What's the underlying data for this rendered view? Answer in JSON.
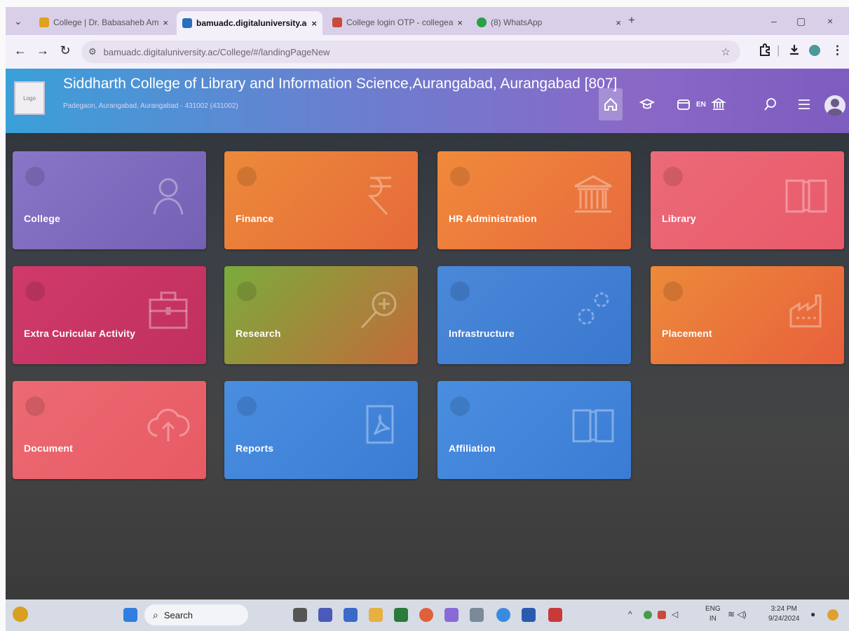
{
  "browser": {
    "tabs": [
      {
        "title": "College | Dr. Babasaheb Ambe",
        "active": false,
        "favicon_color": "#e0a020"
      },
      {
        "title": "bamuadc.digitaluniversity.ac/C",
        "active": true,
        "favicon_color": "#2a6ec0"
      },
      {
        "title": "College login OTP - collegeac",
        "active": false,
        "favicon_color": "#c84a3a"
      },
      {
        "title": "(8) WhatsApp",
        "active": false,
        "favicon_color": "#25a244"
      }
    ],
    "tab_close_glyph": "×",
    "new_tab_glyph": "+",
    "tab_menu_glyph": "⌄",
    "window_controls": {
      "minimize": "–",
      "maximize": "▢",
      "close": "×"
    },
    "url": "bamuadc.digitaluniversity.ac/College/#/landingPageNew",
    "nav": {
      "back": "←",
      "forward": "→",
      "reload": "↻"
    },
    "icons": {
      "site_info": "tune-icon",
      "bookmark": "star-icon",
      "extensions": "puzzle-icon",
      "download": "download-icon",
      "profile": "profile-icon",
      "menu": "kebab-icon"
    }
  },
  "header": {
    "logo_text": "Logo",
    "college_name": "Siddharth College of Library and Information Science,Aurangabad, Aurangabad [807]",
    "address": "Padegaon, Aurangabad, Aurangabad - 431002 (431002)",
    "language": "EN",
    "icons": [
      "home-icon",
      "graduation-cap-icon",
      "folder-icon",
      "institution-icon",
      "search-icon",
      "menu-icon",
      "avatar"
    ]
  },
  "tiles": [
    {
      "label": "College",
      "icon": "user-icon",
      "color_start": "#8a76c8",
      "color_end": "#7460b4"
    },
    {
      "label": "Finance",
      "icon": "rupee-icon",
      "color_start": "#ec8a3a",
      "color_end": "#e66a3a"
    },
    {
      "label": "HR Administration",
      "icon": "bank-icon",
      "color_start": "#f08a3a",
      "color_end": "#e86a3e"
    },
    {
      "label": "Library",
      "icon": "book-icon",
      "color_start": "#ec6a78",
      "color_end": "#e85a6a"
    },
    {
      "label": "Extra Curicular Activity",
      "icon": "briefcase-icon",
      "color_start": "#d03a6a",
      "color_end": "#c0305e"
    },
    {
      "label": "Research",
      "icon": "zoom-in-icon",
      "color_start": "#7aac3c",
      "color_end": "#c46a3a"
    },
    {
      "label": "Infrastructure",
      "icon": "gears-icon",
      "color_start": "#4a88d8",
      "color_end": "#3a78d0"
    },
    {
      "label": "Placement",
      "icon": "factory-icon",
      "color_start": "#ec8a3a",
      "color_end": "#e8603c"
    },
    {
      "label": "Document",
      "icon": "cloud-upload-icon",
      "color_start": "#ec6a72",
      "color_end": "#e85a64"
    },
    {
      "label": "Reports",
      "icon": "pdf-icon",
      "color_start": "#4a8ee0",
      "color_end": "#3a7cd4"
    },
    {
      "label": "Affiliation",
      "icon": "book-icon",
      "color_start": "#4a8ee0",
      "color_end": "#3a7cd4"
    }
  ],
  "taskbar": {
    "search_label": "Search",
    "search_glyph": "⌕",
    "tray_overflow": "^",
    "lang_line1": "ENG",
    "lang_line2": "IN",
    "net_vol_glyph": "≋ ◁)",
    "time": "3:24 PM",
    "date": "9/24/2024",
    "bell_glyph": "●"
  }
}
